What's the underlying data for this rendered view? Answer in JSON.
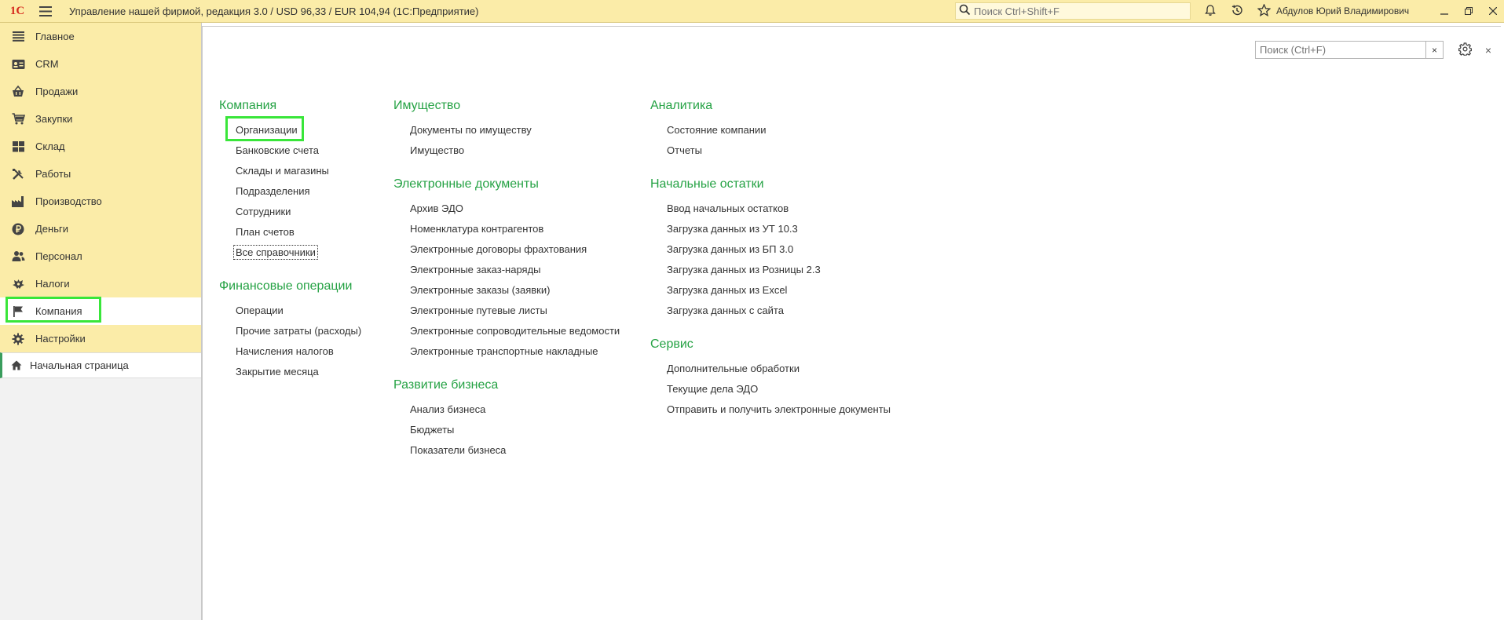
{
  "app": {
    "logo_text": "1С",
    "title": "Управление нашей фирмой, редакция 3.0 / USD 96,33 / EUR 104,94  (1С:Предприятие)",
    "search_placeholder": "Поиск Ctrl+Shift+F",
    "user": "Абдулов Юрий Владимирович"
  },
  "sidebar": {
    "sections": [
      {
        "label": "Главное",
        "icon": "menu-lines-icon"
      },
      {
        "label": "CRM",
        "icon": "crm-card-icon"
      },
      {
        "label": "Продажи",
        "icon": "basket-icon"
      },
      {
        "label": "Закупки",
        "icon": "cart-icon"
      },
      {
        "label": "Склад",
        "icon": "warehouse-icon"
      },
      {
        "label": "Работы",
        "icon": "tools-icon"
      },
      {
        "label": "Производство",
        "icon": "factory-icon"
      },
      {
        "label": "Деньги",
        "icon": "ruble-coin-icon"
      },
      {
        "label": "Персонал",
        "icon": "people-icon"
      },
      {
        "label": "Налоги",
        "icon": "emblem-icon"
      },
      {
        "label": "Компания",
        "icon": "flag-icon"
      },
      {
        "label": "Настройки",
        "icon": "gear-icon"
      }
    ],
    "home_label": "Начальная страница"
  },
  "form": {
    "search_placeholder": "Поиск (Ctrl+F)",
    "clear_label": "×",
    "close_label": "×"
  },
  "columns": [
    {
      "groups": [
        {
          "title": "Компания",
          "links": [
            "Организации",
            "Банковские счета",
            "Склады и магазины",
            "Подразделения",
            "Сотрудники",
            "План счетов",
            "Все справочники"
          ]
        },
        {
          "title": "Финансовые операции",
          "links": [
            "Операции",
            "Прочие затраты (расходы)",
            "Начисления налогов",
            "Закрытие месяца"
          ]
        }
      ]
    },
    {
      "groups": [
        {
          "title": "Имущество",
          "links": [
            "Документы по имуществу",
            "Имущество"
          ]
        },
        {
          "title": "Электронные документы",
          "links": [
            "Архив ЭДО",
            "Номенклатура контрагентов",
            "Электронные договоры фрахтования",
            "Электронные заказ-наряды",
            "Электронные заказы (заявки)",
            "Электронные путевые листы",
            "Электронные сопроводительные ведомости",
            "Электронные транспортные накладные"
          ]
        },
        {
          "title": "Развитие бизнеса",
          "links": [
            "Анализ бизнеса",
            "Бюджеты",
            "Показатели бизнеса"
          ]
        }
      ]
    },
    {
      "groups": [
        {
          "title": "Аналитика",
          "links": [
            "Состояние компании",
            "Отчеты"
          ]
        },
        {
          "title": "Начальные остатки",
          "links": [
            "Ввод начальных остатков",
            "Загрузка данных из УТ 10.3",
            "Загрузка данных из БП 3.0",
            "Загрузка данных из Розницы 2.3",
            "Загрузка данных из Excel",
            "Загрузка данных с сайта"
          ]
        },
        {
          "title": "Сервис",
          "links": [
            "Дополнительные обработки",
            "Текущие дела ЭДО",
            "Отправить и получить электронные документы"
          ]
        }
      ]
    }
  ],
  "colors": {
    "topbar_bg": "#fbeca8",
    "group_title": "#25a244",
    "highlight": "#39e63a"
  }
}
